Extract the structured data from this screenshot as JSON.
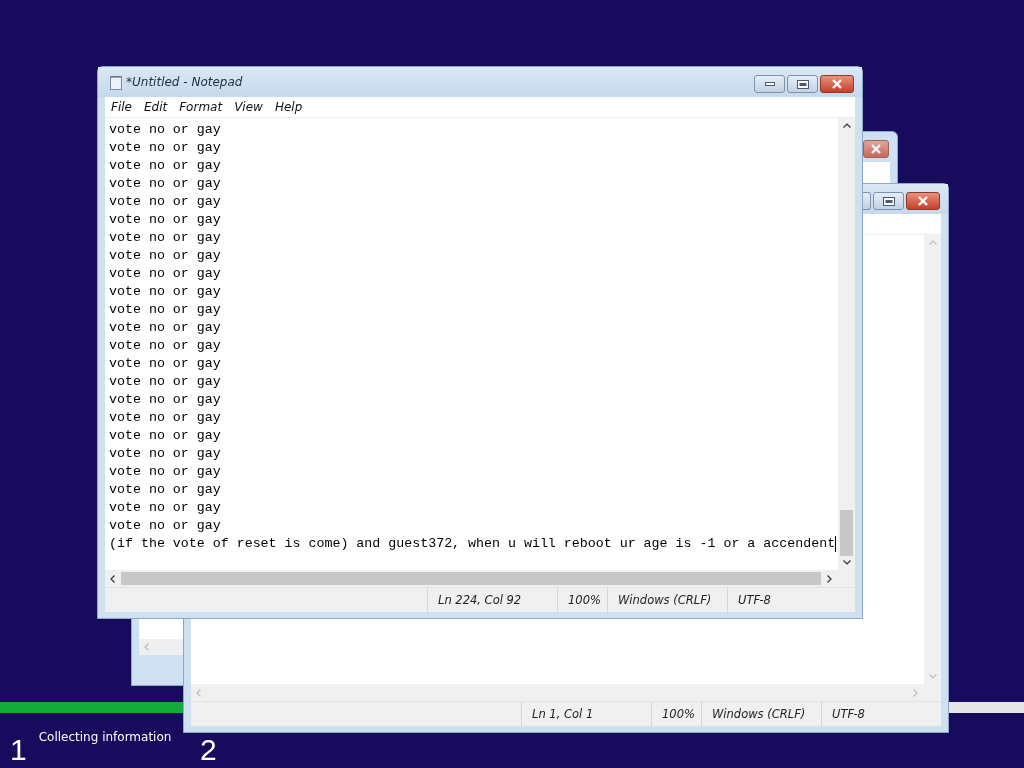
{
  "setup": {
    "steps": [
      {
        "number": "1",
        "label": "Collecting information"
      },
      {
        "number": "2"
      }
    ]
  },
  "back_windows": [
    {
      "kind": "hidden"
    },
    {
      "kind": "notepad",
      "status_bar": [
        "Ln 1, Col 1",
        "100%",
        "Windows (CRLF)",
        "UTF-8"
      ]
    }
  ],
  "notepad": {
    "title": "*Untitled - Notepad",
    "menu": [
      "File",
      "Edit",
      "Format",
      "View",
      "Help"
    ],
    "lines": [
      "vote no or gay",
      "vote no or gay",
      "vote no or gay",
      "vote no or gay",
      "vote no or gay",
      "vote no or gay",
      "vote no or gay",
      "vote no or gay",
      "vote no or gay",
      "vote no or gay",
      "vote no or gay",
      "vote no or gay",
      "vote no or gay",
      "vote no or gay",
      "vote no or gay",
      "vote no or gay",
      "vote no or gay",
      "vote no or gay",
      "vote no or gay",
      "vote no or gay",
      "vote no or gay",
      "vote no or gay",
      "vote no or gay",
      "(if the vote of reset is come) and guest372, when u will reboot ur age is -1 or a accendent"
    ],
    "status_bar": [
      "Ln 224, Col 92",
      "100%",
      "Windows (CRLF)",
      "UTF-8"
    ]
  }
}
